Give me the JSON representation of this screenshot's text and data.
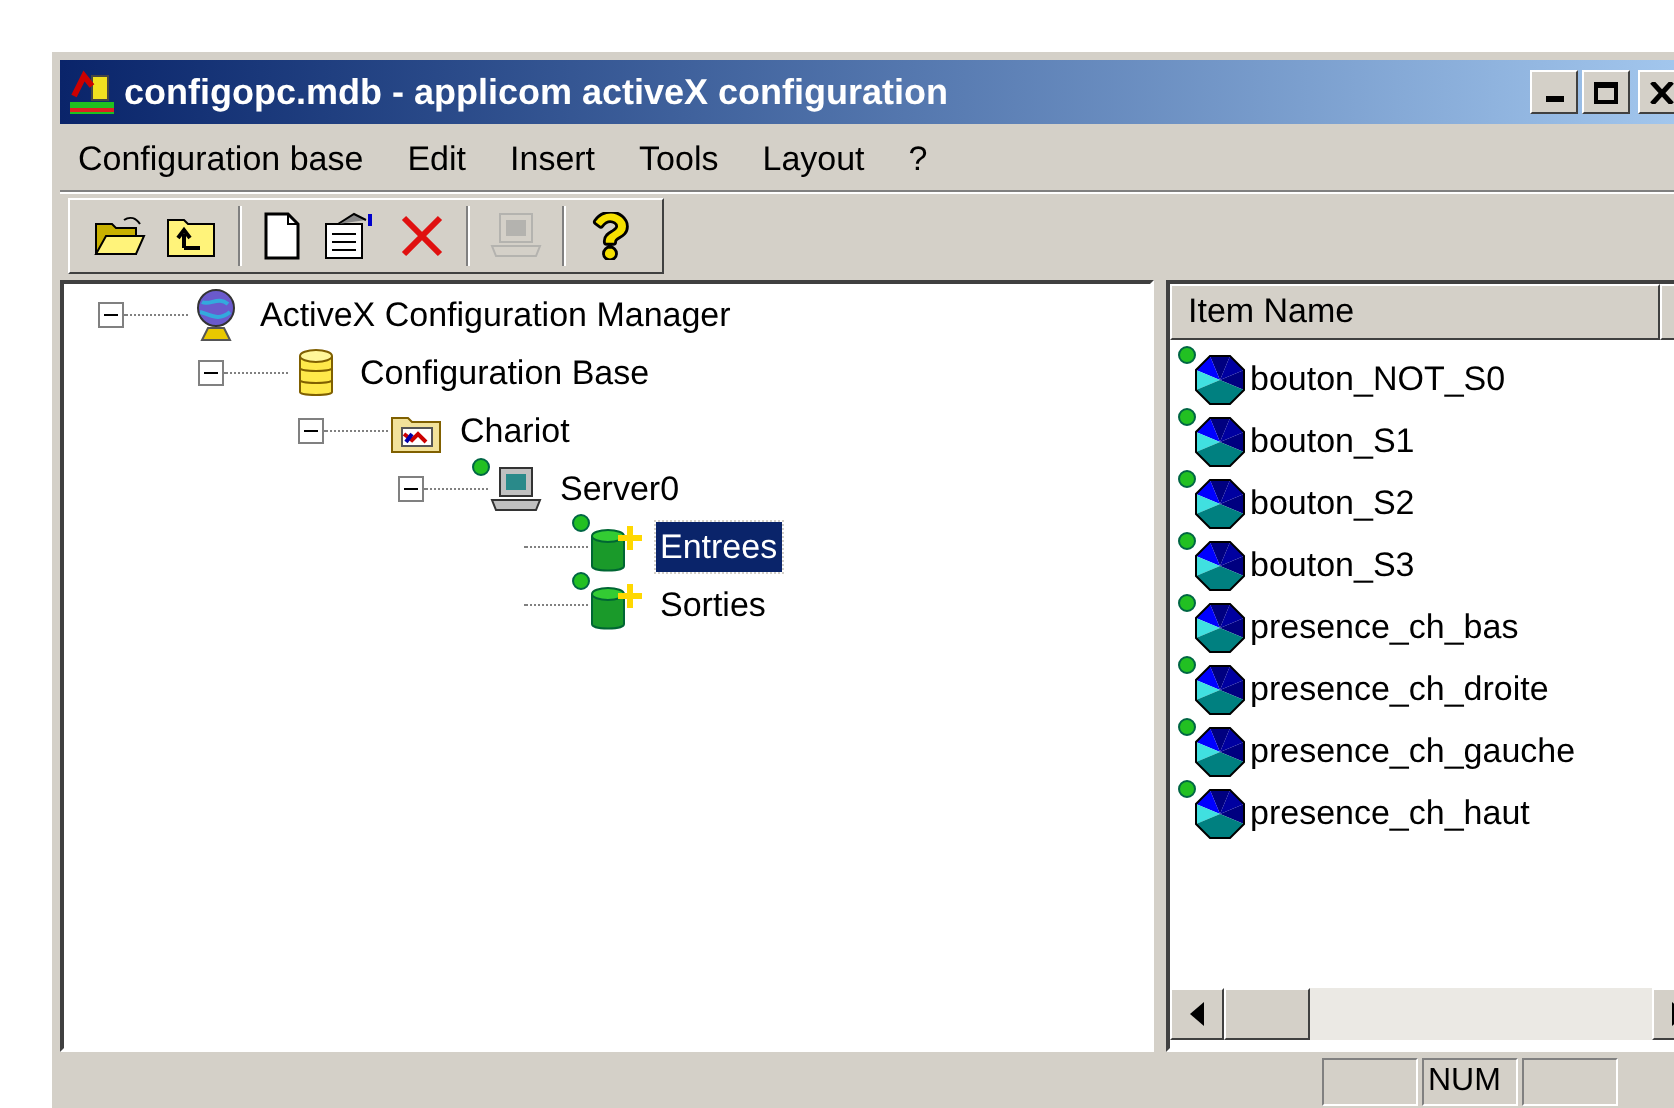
{
  "window": {
    "title": "configopc.mdb - applicom activeX configuration"
  },
  "menu": [
    "Configuration base",
    "Edit",
    "Insert",
    "Tools",
    "Layout",
    "?"
  ],
  "toolbar": [
    {
      "kind": "open",
      "disabled": false
    },
    {
      "kind": "up",
      "disabled": false
    },
    {
      "kind": "separator"
    },
    {
      "kind": "new",
      "disabled": false
    },
    {
      "kind": "properties",
      "disabled": false
    },
    {
      "kind": "delete",
      "disabled": false
    },
    {
      "kind": "separator"
    },
    {
      "kind": "computer",
      "disabled": true
    },
    {
      "kind": "separator"
    },
    {
      "kind": "help",
      "disabled": false
    }
  ],
  "tree": [
    {
      "label": "ActiveX Configuration Manager",
      "kind": "globe",
      "online": false,
      "selected": false,
      "expanded": true,
      "children": [
        {
          "label": "Configuration Base",
          "kind": "database",
          "online": false,
          "selected": false,
          "expanded": true,
          "children": [
            {
              "label": "Chariot",
              "kind": "folder",
              "online": false,
              "selected": false,
              "expanded": true,
              "children": [
                {
                  "label": "Server0",
                  "kind": "computer",
                  "online": true,
                  "selected": false,
                  "expanded": true,
                  "children": [
                    {
                      "label": "Entrees",
                      "kind": "group",
                      "online": true,
                      "selected": true
                    },
                    {
                      "label": "Sorties",
                      "kind": "group",
                      "online": true,
                      "selected": false
                    }
                  ]
                }
              ]
            }
          ]
        }
      ]
    }
  ],
  "list": {
    "columns": [
      "Item Name"
    ],
    "rows": [
      {
        "name": "bouton_NOT_S0",
        "online": true
      },
      {
        "name": "bouton_S1",
        "online": true
      },
      {
        "name": "bouton_S2",
        "online": true
      },
      {
        "name": "bouton_S3",
        "online": true
      },
      {
        "name": "presence_ch_bas",
        "online": true
      },
      {
        "name": "presence_ch_droite",
        "online": true
      },
      {
        "name": "presence_ch_gauche",
        "online": true
      },
      {
        "name": "presence_ch_haut",
        "online": true
      }
    ]
  },
  "status_bar": [
    "NUM"
  ]
}
